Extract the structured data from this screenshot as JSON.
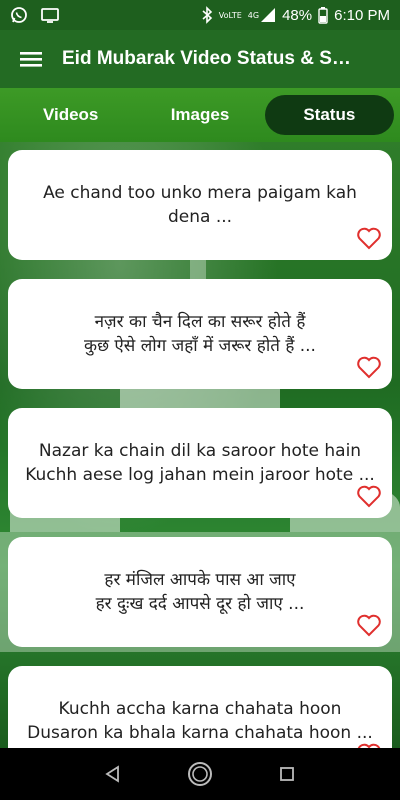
{
  "status_bar": {
    "battery": "48%",
    "time": "6:10 PM",
    "network": "4G",
    "volte": "VoLTE"
  },
  "app_bar": {
    "title": "Eid Mubarak Video Status & S…"
  },
  "tabs": [
    {
      "label": "Videos",
      "active": false
    },
    {
      "label": "Images",
      "active": false
    },
    {
      "label": "Status",
      "active": true
    }
  ],
  "cards": [
    {
      "text": "Ae chand too unko mera paigam kah dena ..."
    },
    {
      "text": "नज़र का चैन दिल का सरूर होते हैं\nकुछ ऐसे लोग जहाँ में जरूर होते हैं ..."
    },
    {
      "text": "Nazar ka chain dil ka saroor hote hain\nKuchh aese log jahan mein jaroor hote ..."
    },
    {
      "text": "हर मंजिल आपके पास आ जाए\nहर दुःख दर्द आपसे दूर हो जाए ..."
    },
    {
      "text": "Kuchh accha karna chahata hoon\nDusaron ka bhala karna chahata hoon ..."
    }
  ],
  "colors": {
    "status_bar": "#1e5f1e",
    "app_bar": "#236b23",
    "tab_bar": "#3d9a26",
    "active_tab": "#0f3a12",
    "heart": "#e0302e"
  },
  "icons": {
    "menu": "menu-icon",
    "favorite": "heart-outline-icon"
  }
}
